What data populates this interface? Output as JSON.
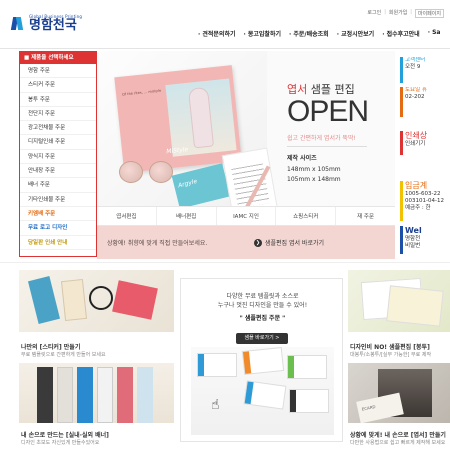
{
  "header": {
    "logo_sub": "Global Business Printing",
    "logo_name": "명함천국",
    "util": {
      "login": "로그인",
      "join": "회원가입",
      "mypage": "마이페이지"
    },
    "gnb": [
      "견적문의하기",
      "몽고입찰하기",
      "주문/배송조회",
      "교정시안보기",
      "접수후고안내",
      "Sa"
    ]
  },
  "left_menu": {
    "head": "제품을 선택하세요",
    "items": [
      "명함 주문",
      "스티커 주문",
      "봉투 주문",
      "전단지 주문",
      "광고전채물 주문",
      "디지털인쇄 주문",
      "양식지 주문",
      "안내장 주문",
      "배너 주문",
      "기타인쇄물 주문"
    ],
    "special": [
      "키엠배 주문",
      "무료 로고 디자인",
      "당일판 인쇄 안내"
    ]
  },
  "banner": {
    "title_pre": "엽서",
    "title_rest": " 샘플 편집",
    "big": "OPEN",
    "desc": "쉽고 간편하게 엽서가 뚝딱!",
    "size_label": "제작 사이즈",
    "size1": "148mm x 105mm",
    "size2": "105mm x 148mm",
    "card_note": "Of the rites, ... mistyle",
    "card_brand": "MiStyle",
    "tabs": [
      "엽서편집",
      "배너편집",
      "IAMC 지인",
      "쇼핑스티커",
      "재 주문"
    ],
    "bottom_left": "상황에! 취향에 맞게 직접 만들어보세요.",
    "bottom_right": "샘플편집 엽서 바로가기",
    "small_card": "Argyle"
  },
  "quick": {
    "q1": [
      "고객센터",
      "오전 9"
    ],
    "q2": [
      "토요일 휴",
      "02-202"
    ],
    "q3": [
      "인쇄상",
      "인쇄기기"
    ],
    "q4": [
      "입금계",
      "1005-603-22",
      "003101-04-12",
      "예금주 : 한"
    ],
    "q5": [
      "Wel",
      "명함천",
      "비밀번"
    ]
  },
  "cards": {
    "sticker": {
      "title": "나만의 [스티커] 만들기",
      "sub": "무료 템플릿으로 간편하게 만들어 보세요"
    },
    "banner": {
      "title": "내 손으로 만드는 [실내·실외 배너]",
      "sub": "디자인 초보도 자신있게 만들수있어요"
    },
    "center": {
      "l1": "다양한 무료 템플릿과 소스로",
      "l2": "누구나 멋진 디자인을 만들 수 있어!",
      "l3": "\" 샘플편집 주문 \"",
      "pill": "샘플 바로가기 >"
    },
    "envelope": {
      "title": "디자인비 NO! 샘플편집 [봉투]",
      "sub": "대봉투/소봉투/[실무 가능한] 무료 제작"
    },
    "postcard": {
      "title": "상황에 맞게! 내 손으로 [엽서] 만들기",
      "sub": "다만한 사용법으로 쉽고 빠르게 제작해 보세요"
    }
  }
}
